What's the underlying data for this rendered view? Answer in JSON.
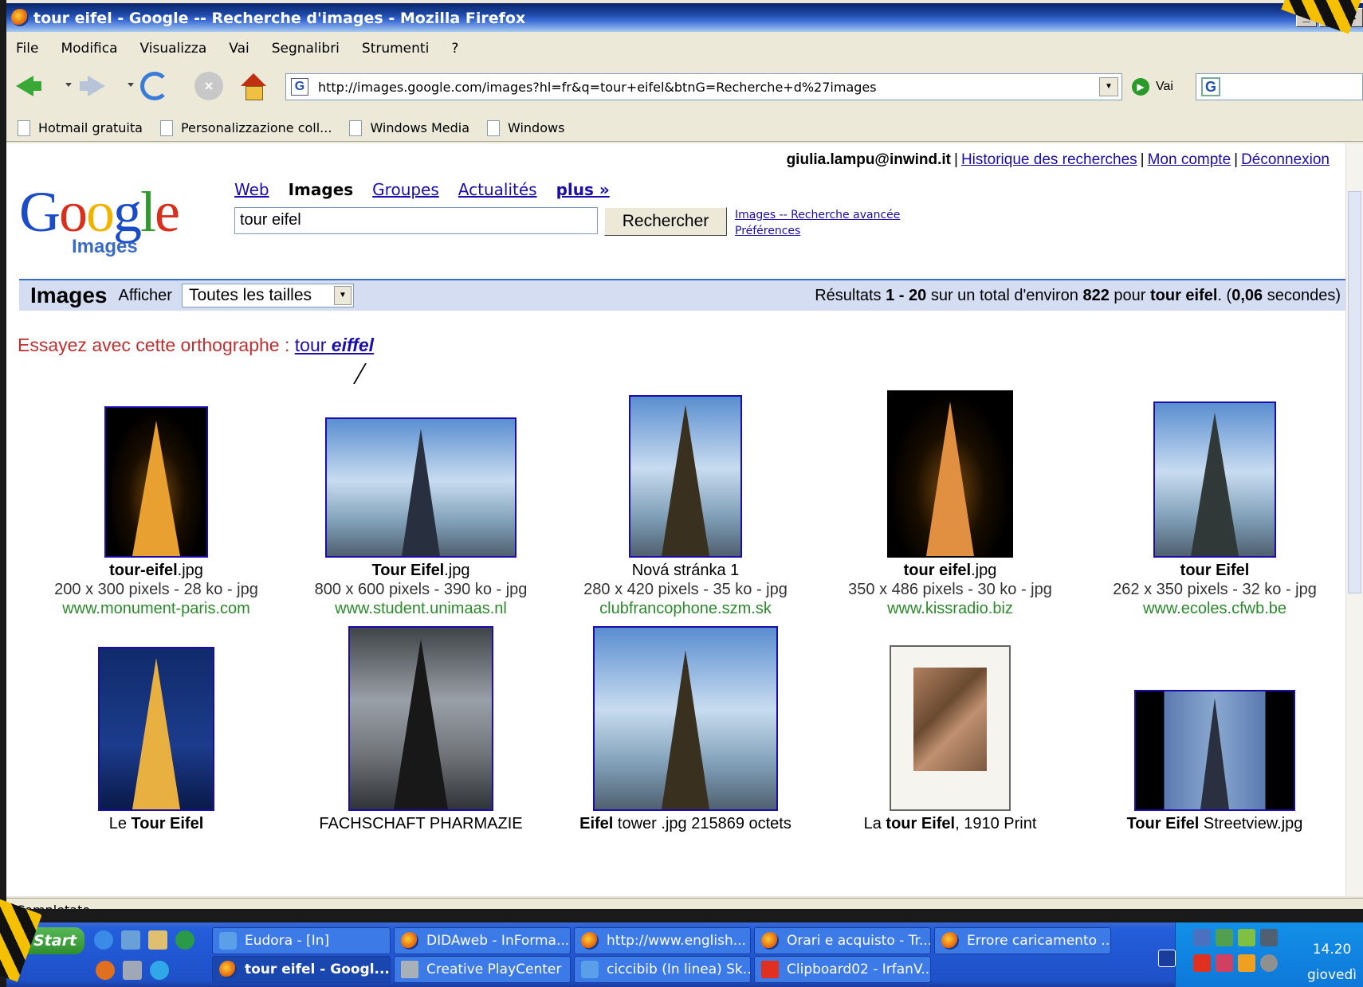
{
  "window": {
    "title": "tour eifel - Google -- Recherche d'images - Mozilla Firefox",
    "controls": [
      "_",
      "□",
      "×"
    ]
  },
  "menu": [
    "File",
    "Modifica",
    "Visualizza",
    "Vai",
    "Segnalibri",
    "Strumenti",
    "?"
  ],
  "toolbar": {
    "url": "http://images.google.com/images?hl=fr&q=tour+eifel&btnG=Recherche+d%27images",
    "go_label": "Vai"
  },
  "bookmarks": [
    "Hotmail gratuita",
    "Personalizzazione coll...",
    "Windows Media",
    "Windows"
  ],
  "page": {
    "user_email": "giulia.lampu@inwind.it",
    "user_links": [
      "Historique des recherches",
      "Mon compte",
      "Déconnexion"
    ],
    "logo_sub": "Images",
    "tabs": [
      "Web",
      "Images",
      "Groupes",
      "Actualités",
      "plus »"
    ],
    "query": "tour eifel",
    "search_button": "Rechercher",
    "advanced_link": "Images -- Recherche avancée",
    "prefs_link": "Préférences",
    "results_heading": "Images",
    "afficher_label": "Afficher",
    "size_select": "Toutes les tailles",
    "stats": {
      "prefix": "Résultats",
      "range": "1 - 20",
      "mid": "sur un total d'environ",
      "total": "822",
      "pour": "pour",
      "query": "tour eifel",
      "time_open": ". (",
      "time": "0,06",
      "time_suffix": "secondes)"
    },
    "spell_prefix": "Essayez avec cette orthographe :",
    "spell_word1": "tour",
    "spell_word2": "eiffel"
  },
  "results": [
    {
      "cap_bold": "tour-eifel",
      "cap_rest": ".jpg",
      "dim": "200 x 300 pixels - 28 ko - jpg",
      "site": "www.monument-paris.com",
      "style": "night"
    },
    {
      "cap_bold": "Tour Eifel",
      "cap_rest": ".jpg",
      "dim": "800 x 600 pixels - 390 ko - jpg",
      "site": "www.student.unimaas.nl",
      "style": "sky"
    },
    {
      "cap_bold": "",
      "cap_rest": "Nová stránka 1",
      "dim": "280 x 420 pixels - 35 ko - jpg",
      "site": "clubfrancophone.szm.sk",
      "style": "sky"
    },
    {
      "cap_bold": "tour eifel",
      "cap_rest": ".jpg",
      "dim": "350 x 486 pixels - 30 ko - jpg",
      "site": "www.kissradio.biz",
      "style": "night"
    },
    {
      "cap_bold": "tour Eifel",
      "cap_rest": "",
      "dim": "262 x 350 pixels - 32 ko - jpg",
      "site": "www.ecoles.cfwb.be",
      "style": "sky"
    },
    {
      "cap_pre": "Le ",
      "cap_bold": "Tour Eifel",
      "cap_rest": "",
      "style": "blue"
    },
    {
      "cap_bold": "",
      "cap_rest": "FACHSCHAFT PHARMAZIE",
      "style": "grey"
    },
    {
      "cap_bold": "Eifel",
      "cap_rest": " tower .jpg 215869 octets",
      "style": "sky"
    },
    {
      "cap_pre": "La ",
      "cap_bold": "tour Eifel",
      "cap_rest": ", 1910 Print",
      "style": "art"
    },
    {
      "cap_bold": "Tour Eifel",
      "cap_rest": " Streetview.jpg",
      "style": "sky"
    }
  ],
  "status": "Completato",
  "taskbar": {
    "start": "Start",
    "row1": [
      "Eudora - [In]",
      "DIDAweb - InForma...",
      "http://www.english...",
      "Orari e acquisto - Tr...",
      "Errore caricamento ..."
    ],
    "row2": [
      "tour eifel - Googl...",
      "Creative PlayCenter",
      "ciccibib (In linea) Sk...",
      "Clipboard02 - IrfanV..."
    ],
    "clock": "14.20",
    "day": "giovedì"
  }
}
